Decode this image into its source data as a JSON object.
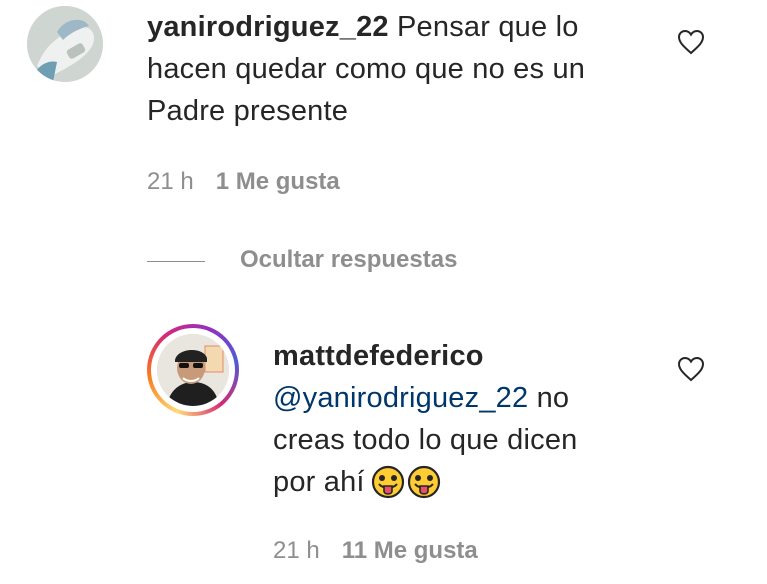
{
  "comment": {
    "username": "yanirodriguez_22",
    "text": "Pensar que lo hacen quedar como que no es un Padre presente",
    "time": "21 h",
    "likes": "1 Me gusta",
    "avatar_icon": "user-avatar"
  },
  "replies_toggle": {
    "label": "Ocultar respuestas"
  },
  "reply": {
    "username": "mattdefederico",
    "mention": "@yanirodriguez_22",
    "text_line1": " no",
    "text_line2": "creas todo lo que dicen",
    "text_line3": "por ahí",
    "emojis": [
      "face-with-tongue-icon",
      "face-with-tongue-icon"
    ],
    "time": "21 h",
    "likes": "11 Me gusta",
    "avatar_icon": "user-avatar-story-ring"
  },
  "icons": {
    "like": "heart-outline-icon"
  },
  "colors": {
    "text": "#262626",
    "muted": "#8e8e8e",
    "mention": "#00376b"
  }
}
